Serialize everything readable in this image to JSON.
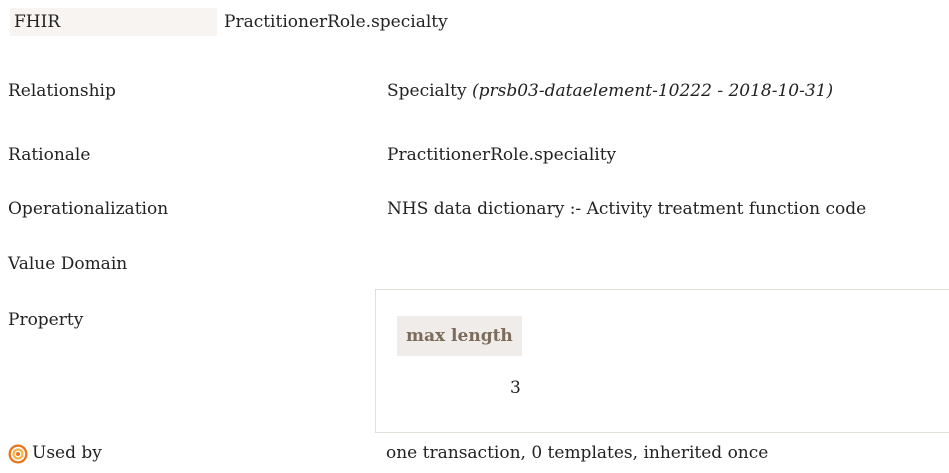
{
  "fhir": {
    "label": "FHIR",
    "value": "PractitionerRole.specialty"
  },
  "relationship": {
    "label": "Relationship",
    "value": "Specialty",
    "ref": "(prsb03-dataelement-10222 - 2018-10-31)"
  },
  "rationale": {
    "label": "Rationale",
    "value": "PractitionerRole.speciality"
  },
  "operationalization": {
    "label": "Operationalization",
    "value": "NHS data dictionary :- Activity treatment function code"
  },
  "value_domain": {
    "label": "Value Domain"
  },
  "property": {
    "label": "Property",
    "header": "max length",
    "value": "3"
  },
  "used_by": {
    "icon": "target-icon",
    "label": "Used by",
    "value": "one transaction, 0 templates, inherited once"
  },
  "colors": {
    "header_text": "#7d6c5b",
    "header_bg": "#efece9",
    "fhir_bg": "#f7f4f1",
    "icon_outer": "#e8731a",
    "icon_ring": "#f6b24a"
  }
}
